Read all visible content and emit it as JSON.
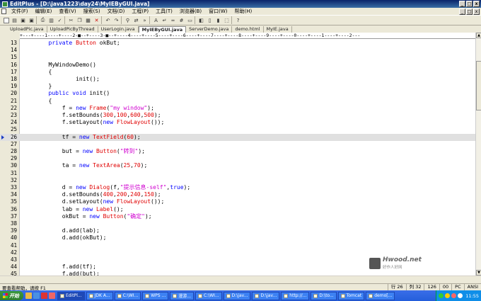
{
  "window": {
    "title": "EditPlus - [D:\\java1223\\day24\\MyIEByGUI.java]",
    "controls": [
      "_",
      "□",
      "x"
    ]
  },
  "menu": {
    "items": [
      "文件(F)",
      "编辑(E)",
      "查看(V)",
      "搜索(S)",
      "文档(D)",
      "工程(P)",
      "工具(T)",
      "浏览器(B)",
      "窗口(W)",
      "帮助(H)"
    ],
    "mdi_controls": [
      "_",
      "□",
      "x"
    ]
  },
  "tabs": [
    {
      "label": "UploadPic.java",
      "active": false
    },
    {
      "label": "UploadPicByThread",
      "active": false
    },
    {
      "label": "UserLogin.java",
      "active": false
    },
    {
      "label": "MyIEByGUI.java",
      "active": true
    },
    {
      "label": "ServerDemo.java",
      "active": false
    },
    {
      "label": "demo.html",
      "active": false
    },
    {
      "label": "MyIE.java",
      "active": false
    }
  ],
  "ruler": "+---+----1----+----2-■--+----3-■--+----4----+----5----+----6----+----7----+----8----+----9----+----0----+----1----+----2---",
  "editor": {
    "current_line": 26,
    "lines": [
      {
        "n": "13",
        "code": [
          [
            "t",
            "        "
          ],
          [
            "kw",
            "private"
          ],
          [
            "t",
            " "
          ],
          [
            "cls",
            "Button"
          ],
          [
            "t",
            " okBut;"
          ]
        ]
      },
      {
        "n": "14",
        "code": []
      },
      {
        "n": "15",
        "code": []
      },
      {
        "n": "16",
        "code": [
          [
            "t",
            "        MyWindowDemo()"
          ]
        ]
      },
      {
        "n": "17",
        "code": [
          [
            "t",
            "        {"
          ]
        ]
      },
      {
        "n": "18",
        "code": [
          [
            "t",
            "                init();"
          ]
        ]
      },
      {
        "n": "19",
        "code": [
          [
            "t",
            "        }"
          ]
        ]
      },
      {
        "n": "20",
        "code": [
          [
            "t",
            "        "
          ],
          [
            "kw",
            "public"
          ],
          [
            "t",
            " "
          ],
          [
            "kw",
            "void"
          ],
          [
            "t",
            " init()"
          ]
        ]
      },
      {
        "n": "21",
        "code": [
          [
            "t",
            "        {"
          ]
        ]
      },
      {
        "n": "22",
        "code": [
          [
            "t",
            "            f = "
          ],
          [
            "kw",
            "new"
          ],
          [
            "t",
            " "
          ],
          [
            "cls",
            "Frame"
          ],
          [
            "t",
            "("
          ],
          [
            "str",
            "\"my window\""
          ],
          [
            "t",
            ");"
          ]
        ]
      },
      {
        "n": "23",
        "code": [
          [
            "t",
            "            f.setBounds("
          ],
          [
            "num",
            "300"
          ],
          [
            "t",
            ","
          ],
          [
            "num",
            "100"
          ],
          [
            "t",
            ","
          ],
          [
            "num",
            "600"
          ],
          [
            "t",
            ","
          ],
          [
            "num",
            "500"
          ],
          [
            "t",
            ");"
          ]
        ]
      },
      {
        "n": "24",
        "code": [
          [
            "t",
            "            f.setLayout("
          ],
          [
            "kw",
            "new"
          ],
          [
            "t",
            " "
          ],
          [
            "cls",
            "FlowLayout"
          ],
          [
            "t",
            "());"
          ]
        ]
      },
      {
        "n": "25",
        "code": []
      },
      {
        "n": "26",
        "code": [
          [
            "t",
            "            tf = "
          ],
          [
            "kw",
            "new"
          ],
          [
            "t",
            " "
          ],
          [
            "cls",
            "TextField"
          ],
          [
            "t",
            "("
          ],
          [
            "num",
            "60"
          ],
          [
            "t",
            ");"
          ]
        ]
      },
      {
        "n": "27",
        "code": []
      },
      {
        "n": "28",
        "code": [
          [
            "t",
            "            but = "
          ],
          [
            "kw",
            "new"
          ],
          [
            "t",
            " "
          ],
          [
            "cls",
            "Button"
          ],
          [
            "t",
            "("
          ],
          [
            "str",
            "\"转到\""
          ],
          [
            "t",
            ");"
          ]
        ]
      },
      {
        "n": "29",
        "code": []
      },
      {
        "n": "30",
        "code": [
          [
            "t",
            "            ta = "
          ],
          [
            "kw",
            "new"
          ],
          [
            "t",
            " "
          ],
          [
            "cls",
            "TextArea"
          ],
          [
            "t",
            "("
          ],
          [
            "num",
            "25"
          ],
          [
            "t",
            ","
          ],
          [
            "num",
            "70"
          ],
          [
            "t",
            ");"
          ]
        ]
      },
      {
        "n": "31",
        "code": []
      },
      {
        "n": "32",
        "code": []
      },
      {
        "n": "33",
        "code": [
          [
            "t",
            "            d = "
          ],
          [
            "kw",
            "new"
          ],
          [
            "t",
            " "
          ],
          [
            "cls",
            "Dialog"
          ],
          [
            "t",
            "(f,"
          ],
          [
            "str",
            "\"提示信息-self\""
          ],
          [
            "t",
            ","
          ],
          [
            "kw",
            "true"
          ],
          [
            "t",
            ");"
          ]
        ]
      },
      {
        "n": "34",
        "code": [
          [
            "t",
            "            d.setBounds("
          ],
          [
            "num",
            "400"
          ],
          [
            "t",
            ","
          ],
          [
            "num",
            "200"
          ],
          [
            "t",
            ","
          ],
          [
            "num",
            "240"
          ],
          [
            "t",
            ","
          ],
          [
            "num",
            "150"
          ],
          [
            "t",
            ");"
          ]
        ]
      },
      {
        "n": "35",
        "code": [
          [
            "t",
            "            d.setLayout("
          ],
          [
            "kw",
            "new"
          ],
          [
            "t",
            " "
          ],
          [
            "cls",
            "FlowLayout"
          ],
          [
            "t",
            "());"
          ]
        ]
      },
      {
        "n": "36",
        "code": [
          [
            "t",
            "            lab = "
          ],
          [
            "kw",
            "new"
          ],
          [
            "t",
            " "
          ],
          [
            "cls",
            "Label"
          ],
          [
            "t",
            "();"
          ]
        ]
      },
      {
        "n": "37",
        "code": [
          [
            "t",
            "            okBut = "
          ],
          [
            "kw",
            "new"
          ],
          [
            "t",
            " "
          ],
          [
            "cls",
            "Button"
          ],
          [
            "t",
            "("
          ],
          [
            "str",
            "\"确定\""
          ],
          [
            "t",
            ");"
          ]
        ]
      },
      {
        "n": "38",
        "code": []
      },
      {
        "n": "39",
        "code": [
          [
            "t",
            "            d.add(lab);"
          ]
        ]
      },
      {
        "n": "40",
        "code": [
          [
            "t",
            "            d.add(okBut);"
          ]
        ]
      },
      {
        "n": "41",
        "code": []
      },
      {
        "n": "42",
        "code": []
      },
      {
        "n": "43",
        "code": []
      },
      {
        "n": "44",
        "code": [
          [
            "t",
            "            f.add(tf);"
          ]
        ]
      },
      {
        "n": "45",
        "code": [
          [
            "t",
            "            f.add(but);"
          ]
        ]
      }
    ]
  },
  "watermark": {
    "text": "Hwood.net",
    "sub": "好作人好网"
  },
  "status": {
    "message": "要查看帮助，请按 F1",
    "cells": [
      "行 26",
      "列 32",
      "126",
      "00",
      "PC",
      "ANSI"
    ]
  },
  "taskbar": {
    "start": "开始",
    "tasks": [
      {
        "label": "EditPl...",
        "active": true
      },
      {
        "label": "JDK A...",
        "active": false
      },
      {
        "label": "C:\\WI...",
        "active": false
      },
      {
        "label": "WPS ...",
        "active": false
      },
      {
        "label": "漫游...",
        "active": false
      },
      {
        "label": "C:\\WI...",
        "active": false
      },
      {
        "label": "D:\\jav...",
        "active": false
      },
      {
        "label": "D:\\jav...",
        "active": false
      },
      {
        "label": "http://...",
        "active": false
      },
      {
        "label": "D:\\to...",
        "active": false
      },
      {
        "label": "Tomcat",
        "active": false
      },
      {
        "label": "demo[...",
        "active": false
      }
    ],
    "clock": "11:55"
  },
  "colors": {
    "keyword": "#0000ff",
    "class": "#e00000",
    "string": "#d000d0",
    "number": "#e00000",
    "current_line": "#e0e0e0"
  }
}
